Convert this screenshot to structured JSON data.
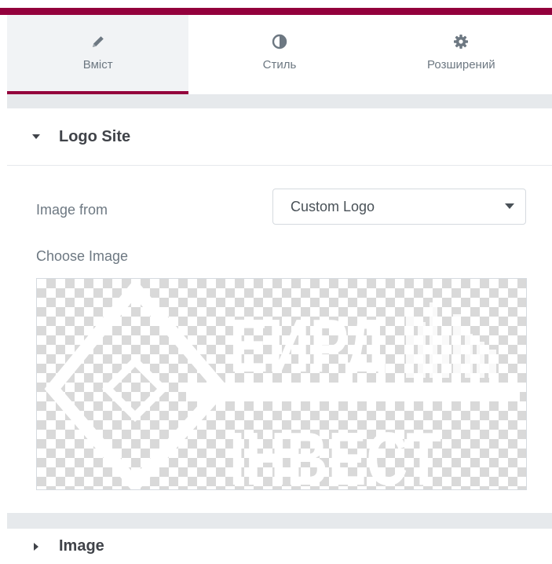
{
  "tabs": [
    {
      "label": "Вміст",
      "icon": "pencil-icon",
      "active": true
    },
    {
      "label": "Стиль",
      "icon": "half-circle-icon",
      "active": false
    },
    {
      "label": "Розширений",
      "icon": "gear-icon",
      "active": false
    }
  ],
  "colors": {
    "accent": "#93003c",
    "panel_band": "#e6e9ec",
    "label_text": "#6d7882",
    "heading_text": "#404349"
  },
  "sections": {
    "logo_site": {
      "title": "Logo Site",
      "expanded": true,
      "caret_icon": "caret-down-icon"
    },
    "image": {
      "title": "Image",
      "expanded": false,
      "caret_icon": "caret-right-icon"
    }
  },
  "controls": {
    "image_from": {
      "label": "Image from",
      "value": "Custom Logo"
    },
    "choose_image": {
      "label": "Choose Image"
    }
  },
  "logo_preview": {
    "line1": "ЕИРД",
    "line2": "ІНВЕСТ"
  }
}
